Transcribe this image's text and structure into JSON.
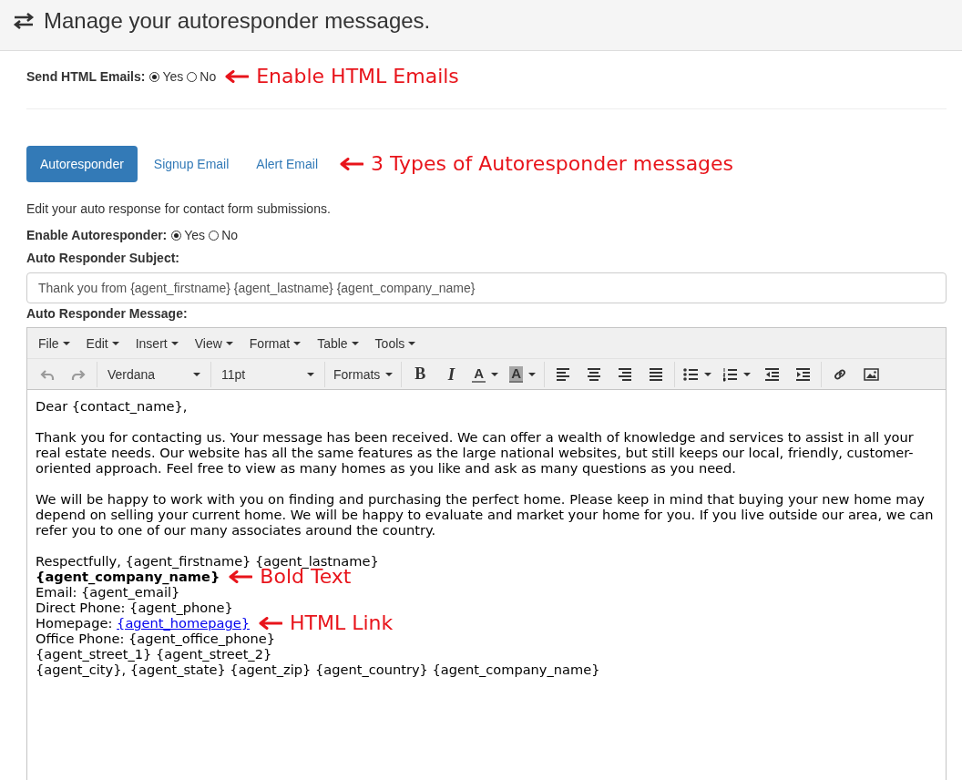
{
  "page_header": {
    "title": "Manage your autoresponder messages."
  },
  "send_html": {
    "label": "Send HTML Emails:",
    "options": [
      {
        "label": "Yes",
        "selected": true
      },
      {
        "label": "No",
        "selected": false
      }
    ],
    "annotation": "Enable HTML Emails"
  },
  "tabs": [
    {
      "label": "Autoresponder",
      "selected": true
    },
    {
      "label": "Signup Email",
      "selected": false
    },
    {
      "label": "Alert Email",
      "selected": false
    }
  ],
  "tabs_annotation": "3 Types of Autoresponder messages",
  "description": "Edit your auto response for contact form submissions.",
  "enable_autoresponder": {
    "label": "Enable Autoresponder:",
    "options": [
      {
        "label": "Yes",
        "selected": true
      },
      {
        "label": "No",
        "selected": false
      }
    ]
  },
  "subject": {
    "label": "Auto Responder Subject:",
    "value": "Thank you from {agent_firstname} {agent_lastname} {agent_company_name}"
  },
  "message": {
    "label": "Auto Responder Message:",
    "menu": [
      "File",
      "Edit",
      "Insert",
      "View",
      "Format",
      "Table",
      "Tools"
    ],
    "toolbar": [
      [
        {
          "kind": "undo",
          "disabled": true
        },
        {
          "kind": "redo",
          "disabled": true
        }
      ],
      [
        {
          "kind": "select",
          "value": "Verdana"
        }
      ],
      [
        {
          "kind": "select",
          "value": "11pt"
        }
      ],
      [
        {
          "kind": "menu",
          "label": "Formats"
        }
      ],
      [
        {
          "kind": "bold",
          "label": "B"
        },
        {
          "kind": "italic",
          "label": "I"
        },
        {
          "kind": "text-color",
          "label": "A"
        },
        {
          "kind": "bg-color",
          "label": "A"
        }
      ],
      [
        {
          "kind": "align-left"
        },
        {
          "kind": "align-center"
        },
        {
          "kind": "align-right"
        },
        {
          "kind": "justify"
        }
      ],
      [
        {
          "kind": "bullet-list"
        },
        {
          "kind": "numbered-list"
        },
        {
          "kind": "outdent"
        },
        {
          "kind": "indent"
        }
      ],
      [
        {
          "kind": "link"
        },
        {
          "kind": "image"
        }
      ]
    ],
    "body": [
      {
        "kind": "text",
        "text": "Dear {contact_name},"
      },
      {
        "kind": "text",
        "text": "Thank you for contacting us. Your message has been received. We can offer a wealth of knowledge and services to assist in all your real estate needs. Our website has all the same features as the large national websites, but still keeps our local, friendly, customer-oriented approach. Feel free to view as many homes as you like and ask as many questions as you need."
      },
      {
        "kind": "text",
        "text": "We will be happy to work with you on finding and purchasing the perfect home. Please keep in mind that buying your new home may depend on selling your current home. We will be happy to evaluate and market your home for you. If you live outside our area, we can refer you to one of our many associates around the country."
      }
    ],
    "signature": [
      {
        "kind": "text",
        "text": "Respectfully, {agent_firstname} {agent_lastname}"
      },
      {
        "kind": "bold",
        "text": "{agent_company_name}",
        "annotation": "Bold Text"
      },
      {
        "kind": "text",
        "text": "Email: {agent_email}"
      },
      {
        "kind": "text",
        "text": "Direct Phone: {agent_phone}"
      },
      {
        "kind": "link",
        "text": "Homepage: ",
        "link": "{agent_homepage}",
        "annotation": "HTML Link"
      },
      {
        "kind": "text",
        "text": "Office Phone: {agent_office_phone}"
      },
      {
        "kind": "text",
        "text": "{agent_street_1} {agent_street_2}"
      },
      {
        "kind": "text",
        "text": "{agent_city}, {agent_state} {agent_zip} {agent_country} {agent_company_name}"
      }
    ]
  }
}
